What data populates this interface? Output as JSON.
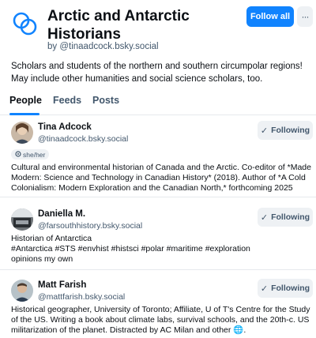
{
  "header": {
    "title": "Arctic and Antarctic Historians",
    "byline": "by @tinaadcock.bsky.social",
    "follow_all_label": "Follow all",
    "more_label": "···",
    "accent_color": "#1083fe"
  },
  "description": "Scholars and students of the northern and southern circumpolar regions! May include other humanities and social science scholars, too.",
  "tabs": [
    {
      "label": "People",
      "active": true
    },
    {
      "label": "Feeds",
      "active": false
    },
    {
      "label": "Posts",
      "active": false
    }
  ],
  "people": [
    {
      "name": "Tina Adcock",
      "handle": "@tinaadcock.bsky.social",
      "button": "Following",
      "pronouns": "she/her",
      "bio": "Cultural and environmental historian of Canada and the Arctic. Co-editor of *Made Modern: Science and Technology in Canadian History* (2018). Author of *A Cold Colonialism: Modern Exploration and the Canadian North,* forthcoming 2025"
    },
    {
      "name": "Daniella M.",
      "handle": "@farsouthhistory.bsky.social",
      "button": "Following",
      "bio_lines": [
        "Historian of Antarctica",
        "#Antarctica #STS #envhist #histsci #polar #maritime #exploration",
        "opinions my own"
      ]
    },
    {
      "name": "Matt Farish",
      "handle": "@mattfarish.bsky.social",
      "button": "Following",
      "bio": "Historical geographer, University of Toronto; Affiliate, U of T's Centre for the Study of the US. Writing a book about climate labs, survival schools, and the 20th-c. US militarization of the planet. Distracted by AC Milan and other 🌐."
    }
  ]
}
